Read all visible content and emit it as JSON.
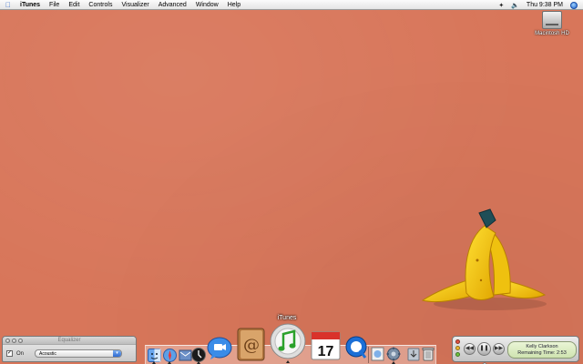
{
  "menubar": {
    "app_name": "iTunes",
    "items": [
      "File",
      "Edit",
      "Controls",
      "Visualizer",
      "Advanced",
      "Window",
      "Help"
    ],
    "clock": "Thu 9:38 PM",
    "icons": [
      "apple-icon",
      "bluetooth-icon",
      "volume-icon",
      "spotlight-icon"
    ]
  },
  "desktop": {
    "background_color": "#d8765a",
    "drive_label": "Macintosh HD"
  },
  "dock": {
    "hover_label": "iTunes",
    "icons": [
      "finder",
      "safari",
      "mail",
      "dashboard",
      "ichat",
      "address-book",
      "itunes",
      "ical",
      "quicktime",
      "preview",
      "system-preferences",
      "downloads",
      "trash"
    ]
  },
  "equalizer": {
    "title": "Equalizer",
    "on_label": "On",
    "preset": "Acoustic",
    "checked": true
  },
  "mini_player": {
    "artist": "Kelly Clarkson",
    "remaining": "Remaining Time: 2:53"
  }
}
